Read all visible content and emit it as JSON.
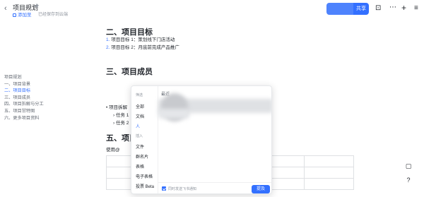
{
  "header": {
    "back_icon": "chevron-left-icon",
    "title": "项目规划",
    "star_icon": "star-icon",
    "add_tab": "添加至",
    "saved": "已经保存到云端",
    "share": "共享",
    "accent": "#3370ff"
  },
  "outline": {
    "items": [
      {
        "label": "项目规划",
        "active": false
      },
      {
        "label": "一、项目背景",
        "active": false
      },
      {
        "label": "二、项目目标",
        "active": true
      },
      {
        "label": "三、项目成员",
        "active": false
      },
      {
        "label": "四、项目拆解与分工",
        "active": false
      },
      {
        "label": "五、项目甘特图",
        "active": false
      },
      {
        "label": "六、更多项目资料",
        "active": false
      }
    ]
  },
  "doc": {
    "h2_goals": "二、项目目标",
    "goals": [
      {
        "n": "1.",
        "text": "项目目标 1：策划线下门店活动"
      },
      {
        "n": "2.",
        "text": "项目目标 2：月底前完成产品推广"
      }
    ],
    "h2_members": "三、项目成员",
    "bullet": "项目拆解",
    "sub1": "任务 1",
    "sub2": "任务 2",
    "h2_gantt": "五、项目",
    "usage": "使用@"
  },
  "popup": {
    "filter_header": "筛选",
    "filters": [
      "全部",
      "文档",
      "人"
    ],
    "insert_header": "插入",
    "inserts": [
      "文件",
      "群名片",
      "表格",
      "电子表格",
      "投票 Beta"
    ],
    "active": "人",
    "recent": "最近",
    "notify_label": "同时发送飞书通知",
    "submit": "提及"
  }
}
